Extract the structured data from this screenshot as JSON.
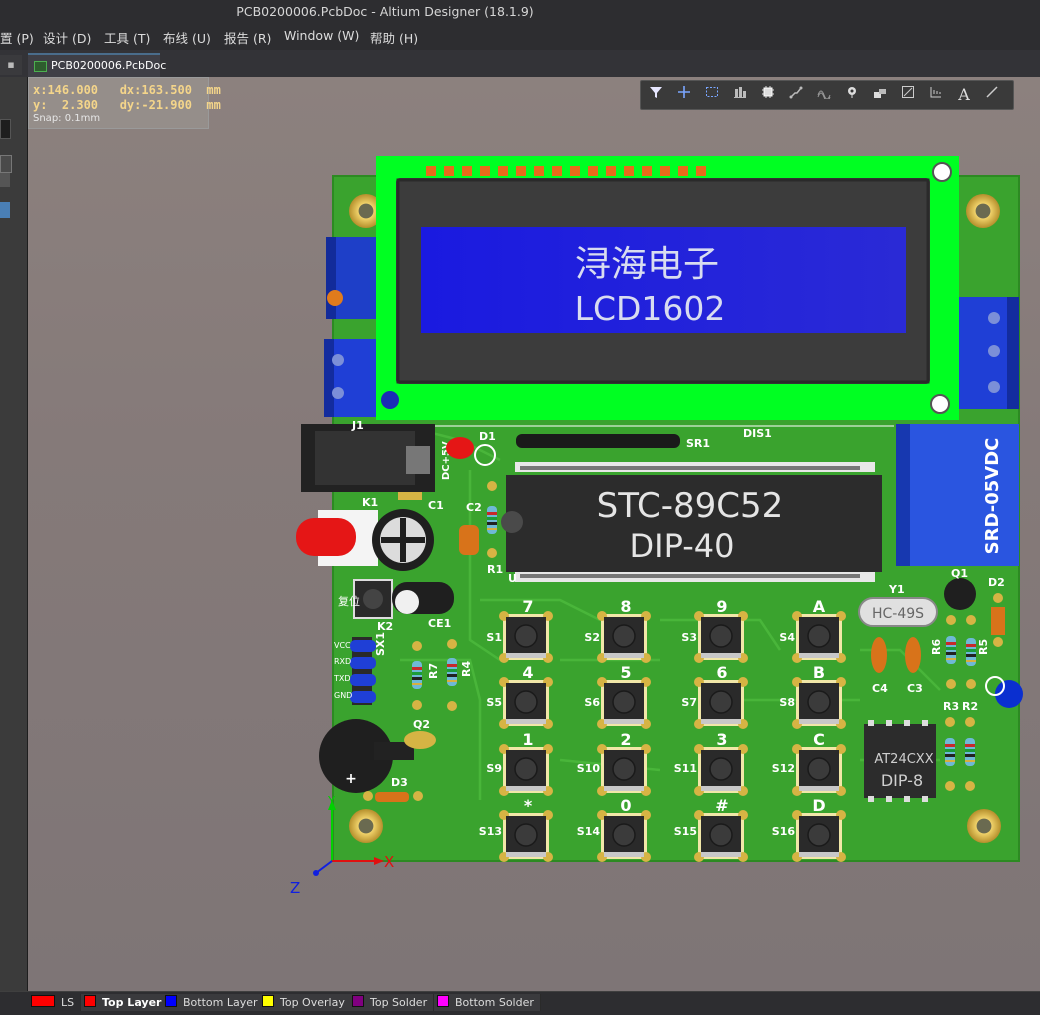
{
  "window": {
    "title": "PCB0200006.PcbDoc - Altium Designer (18.1.9)"
  },
  "menu": [
    {
      "label": "置 (P)"
    },
    {
      "label": "设计 (D)"
    },
    {
      "label": "工具 (T)"
    },
    {
      "label": "布线 (U)"
    },
    {
      "label": "报告 (R)"
    },
    {
      "label": "Window (W)"
    },
    {
      "label": "帮助 (H)"
    }
  ],
  "tabs": [
    {
      "label": "PCB0200006.PcbDoc",
      "active": true
    }
  ],
  "coords": {
    "row1": "x:146.000   dx:163.500  mm",
    "row2": "y:  2.300   dy:-21.900  mm",
    "snap": "Snap: 0.1mm"
  },
  "toolbar": {
    "items": [
      "filter-icon",
      "crosshair-icon",
      "select-rect-icon",
      "align-icon",
      "component-icon",
      "route-icon",
      "diff-pair-icon",
      "via-icon",
      "fill-icon",
      "polygon-icon",
      "dimension-icon",
      "text-icon",
      "line-icon"
    ],
    "text_glyph": "A"
  },
  "board": {
    "lcd": {
      "line1": "浔海电子",
      "line2": "LCD1602"
    },
    "mcu": {
      "line1": "STC-89C52",
      "line2": "DIP-40"
    },
    "relay": {
      "label": "SRD-05VDC"
    },
    "eeprom": {
      "line1": "AT24CXX",
      "line2": "DIP-8"
    },
    "crystal": {
      "label": "HC-49S"
    },
    "reset_text": "复位",
    "designators": {
      "J1": "J1",
      "D1": "D1",
      "SR1": "SR1",
      "DIS1": "DIS1",
      "K1": "K1",
      "C1": "C1",
      "C2": "C2",
      "R1": "R1",
      "U": "U",
      "Q1": "Q1",
      "D2": "D2",
      "Y1": "Y1",
      "K2": "K2",
      "CE1": "CE1",
      "SX1": "SX1",
      "R7": "R7",
      "R4": "R4",
      "R6": "R6",
      "R5": "R5",
      "C4": "C4",
      "C3": "C3",
      "R3": "R3",
      "R2": "R2",
      "Q2": "Q2",
      "D3": "D3",
      "DC": "DC+5V"
    },
    "header_pins": [
      "VCC",
      "RXD",
      "TXD",
      "GND"
    ],
    "keys": [
      {
        "label": "7",
        "ref": "S1"
      },
      {
        "label": "8",
        "ref": "S2"
      },
      {
        "label": "9",
        "ref": "S3"
      },
      {
        "label": "A",
        "ref": "S4"
      },
      {
        "label": "4",
        "ref": "S5"
      },
      {
        "label": "5",
        "ref": "S6"
      },
      {
        "label": "6",
        "ref": "S7"
      },
      {
        "label": "B",
        "ref": "S8"
      },
      {
        "label": "1",
        "ref": "S9"
      },
      {
        "label": "2",
        "ref": "S10"
      },
      {
        "label": "3",
        "ref": "S11"
      },
      {
        "label": "C",
        "ref": "S12"
      },
      {
        "label": "*",
        "ref": "S13"
      },
      {
        "label": "0",
        "ref": "S14"
      },
      {
        "label": "#",
        "ref": "S15"
      },
      {
        "label": "D",
        "ref": "S16"
      }
    ],
    "axes": {
      "x": "X",
      "y": "Y",
      "z": "Z"
    }
  },
  "layers": [
    {
      "label": "LS",
      "color": "#ff0000",
      "active": false
    },
    {
      "label": "Top Layer",
      "color": "#ff0000",
      "active": true
    },
    {
      "label": "Bottom Layer",
      "color": "#0000ff",
      "active": false
    },
    {
      "label": "Top Overlay",
      "color": "#ffff00",
      "active": false
    },
    {
      "label": "Top Solder",
      "color": "#800080",
      "active": false
    },
    {
      "label": "Bottom Solder",
      "color": "#ff00ff",
      "active": false
    }
  ]
}
